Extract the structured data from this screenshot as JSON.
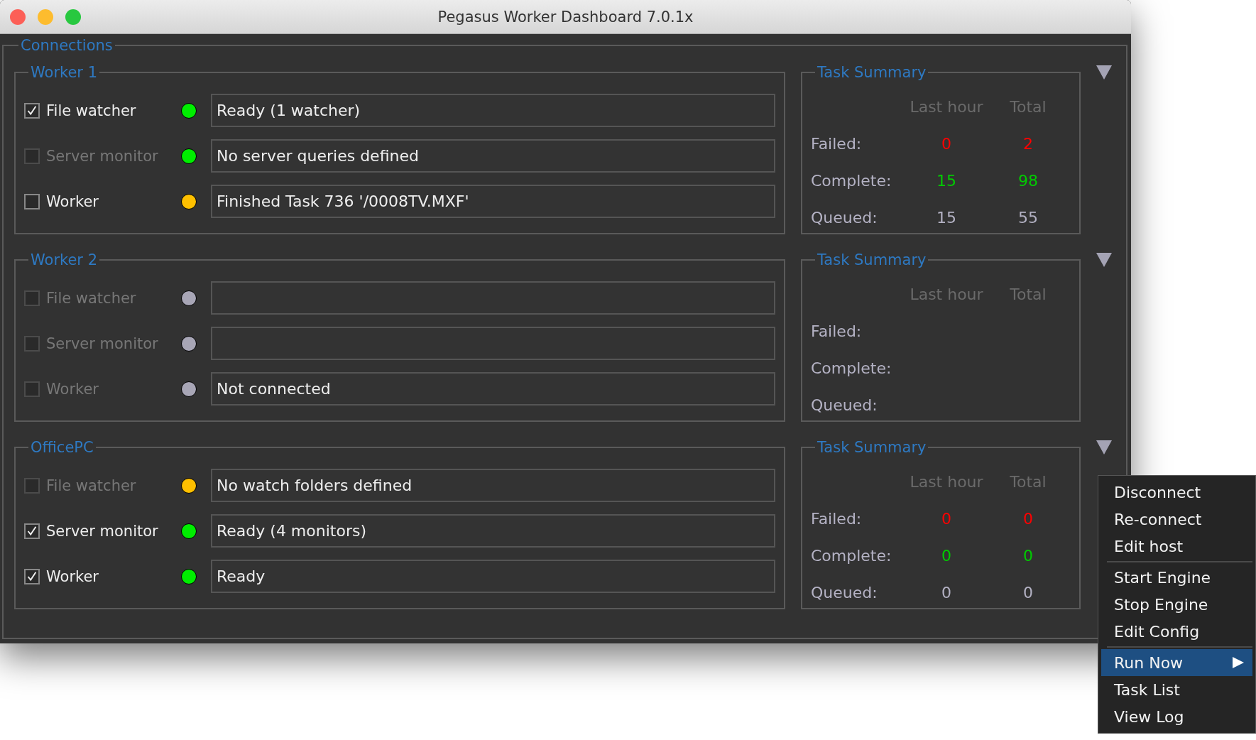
{
  "window": {
    "title": "Pegasus Worker Dashboard 7.0.1x"
  },
  "connections": {
    "title": "Connections",
    "hosts": [
      {
        "name": "Worker 1",
        "services": [
          {
            "label": "File watcher",
            "checked": true,
            "disabled": false,
            "color": "#00ee00",
            "status": "Ready (1 watcher)"
          },
          {
            "label": "Server monitor",
            "checked": false,
            "disabled": true,
            "color": "#00ee00",
            "status": "No server queries defined"
          },
          {
            "label": "Worker",
            "checked": false,
            "disabled": false,
            "color": "#ffc000",
            "status": "Finished Task 736 '/0008TV.MXF'"
          }
        ],
        "summary": {
          "title": "Task Summary",
          "headers": [
            "Last hour",
            "Total"
          ],
          "rows": [
            {
              "label": "Failed:",
              "kind": "failed",
              "last_hour": "0",
              "total": "2"
            },
            {
              "label": "Complete:",
              "kind": "complete",
              "last_hour": "15",
              "total": "98"
            },
            {
              "label": "Queued:",
              "kind": "queued",
              "last_hour": "15",
              "total": "55"
            }
          ]
        }
      },
      {
        "name": "Worker 2",
        "services": [
          {
            "label": "File watcher",
            "checked": false,
            "disabled": true,
            "color": "#a8a6b6"
          },
          {
            "label": "Server monitor",
            "checked": false,
            "disabled": true,
            "color": "#a8a6b6"
          },
          {
            "label": "Worker",
            "checked": false,
            "disabled": true,
            "color": "#a8a6b6",
            "status": "Not connected"
          }
        ],
        "summary": {
          "title": "Task Summary",
          "headers": [
            "Last hour",
            "Total"
          ],
          "rows": [
            {
              "label": "Failed:"
            },
            {
              "label": "Complete:"
            },
            {
              "label": "Queued:"
            }
          ]
        }
      },
      {
        "name": "OfficePC",
        "services": [
          {
            "label": "File watcher",
            "checked": false,
            "disabled": true,
            "color": "#ffc000",
            "status": "No watch folders defined"
          },
          {
            "label": "Server monitor",
            "checked": true,
            "disabled": false,
            "color": "#00ee00",
            "status": "Ready (4 monitors)"
          },
          {
            "label": "Worker",
            "checked": true,
            "disabled": false,
            "color": "#00ee00",
            "status": "Ready"
          }
        ],
        "summary": {
          "title": "Task Summary",
          "headers": [
            "Last hour",
            "Total"
          ],
          "rows": [
            {
              "label": "Failed:",
              "kind": "failed",
              "last_hour": "0",
              "total": "0"
            },
            {
              "label": "Complete:",
              "kind": "complete",
              "last_hour": "0",
              "total": "0"
            },
            {
              "label": "Queued:",
              "kind": "queued",
              "last_hour": "0",
              "total": "0"
            }
          ]
        }
      }
    ]
  },
  "context_menu": {
    "groups": [
      [
        {
          "label": "Disconnect",
          "selected": false
        },
        {
          "label": "Re-connect",
          "selected": false
        },
        {
          "label": "Edit host",
          "selected": false
        }
      ],
      [
        {
          "label": "Start Engine",
          "selected": false
        },
        {
          "label": "Stop Engine",
          "selected": false
        },
        {
          "label": "Edit Config",
          "selected": false
        }
      ],
      [
        {
          "label": "Run Now",
          "selected": true,
          "kind": "submenu"
        },
        {
          "label": "Task List",
          "selected": false,
          "kind": "item"
        },
        {
          "label": "View Log",
          "selected": false,
          "kind": "item"
        }
      ]
    ]
  }
}
